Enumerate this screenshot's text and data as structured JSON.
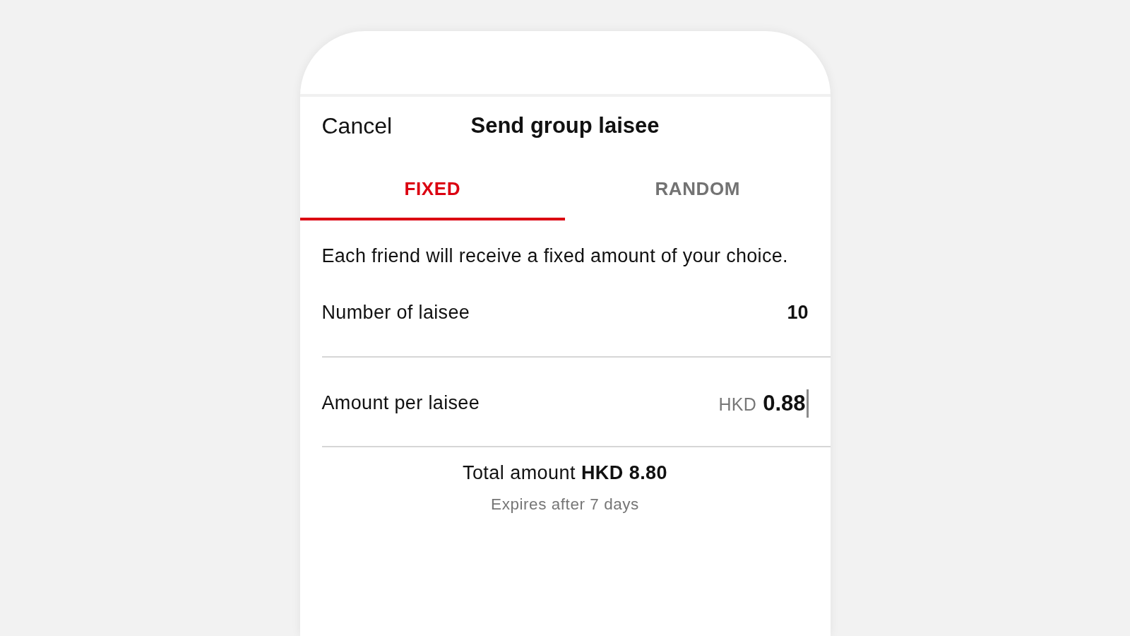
{
  "header": {
    "cancel": "Cancel",
    "title": "Send group laisee"
  },
  "tabs": [
    {
      "label": "FIXED",
      "selected": true
    },
    {
      "label": "RANDOM",
      "selected": false
    }
  ],
  "description": "Each friend will receive a fixed amount of your choice.",
  "fields": [
    {
      "kind": "count",
      "label": "Number of laisee",
      "value": "10"
    },
    {
      "kind": "amount",
      "label": "Amount per laisee",
      "currency": "HKD",
      "value": "0.88",
      "focused": true
    }
  ],
  "total": "Total amount **HKD 8.80**",
  "expiry": "Expires after 7 days"
}
